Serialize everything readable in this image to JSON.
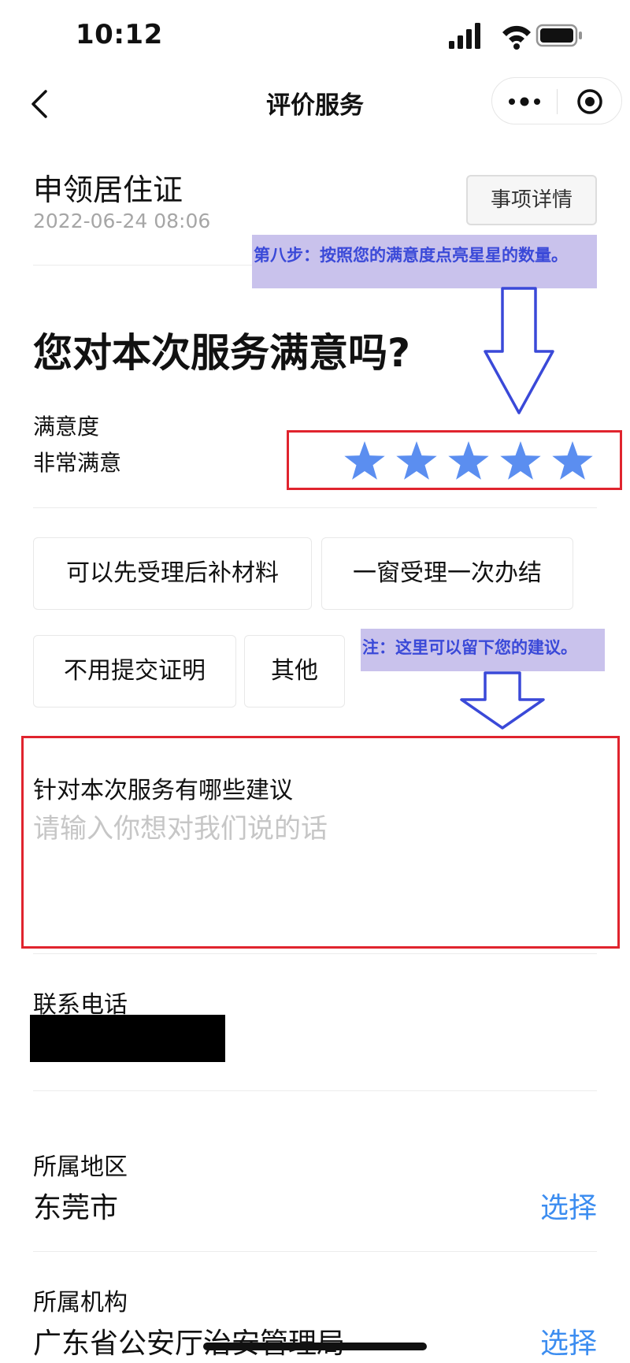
{
  "status_bar": {
    "time": "10:12",
    "icons": [
      "signal-icon",
      "wifi-icon",
      "battery-icon"
    ]
  },
  "nav": {
    "title": "评价服务",
    "back_icon": "chevron-left-icon",
    "more_icon": "more-icon",
    "close_icon": "target-icon"
  },
  "service": {
    "name": "申领居住证",
    "datetime": "2022-06-24 08:06",
    "detail_button": "事项详情"
  },
  "annotations": {
    "step8": "第八步：按照您的满意度点亮星星的数量。",
    "note": "注：这里可以留下您的建议。"
  },
  "rating": {
    "question": "您对本次服务满意吗?",
    "label": "满意度",
    "value_text": "非常满意",
    "stars_filled": 5,
    "stars_total": 5,
    "star_color": "#5b8ef0"
  },
  "tags": [
    {
      "label": "可以先受理后补材料"
    },
    {
      "label": "一窗受理一次办结"
    },
    {
      "label": "不用提交证明"
    },
    {
      "label": "其他"
    }
  ],
  "suggestion": {
    "label": "针对本次服务有哪些建议",
    "placeholder": "请输入你想对我们说的话",
    "value": ""
  },
  "contact": {
    "label": "联系电话"
  },
  "region": {
    "label": "所属地区",
    "value": "东莞市",
    "action": "选择"
  },
  "agency": {
    "label": "所属机构",
    "value": "广东省公安厅治安管理局",
    "action": "选择"
  },
  "colors": {
    "highlight_border": "#e0242e",
    "annotation_bg": "#c9c2ec",
    "annotation_text": "#3a49d8",
    "link": "#3c8df0"
  }
}
